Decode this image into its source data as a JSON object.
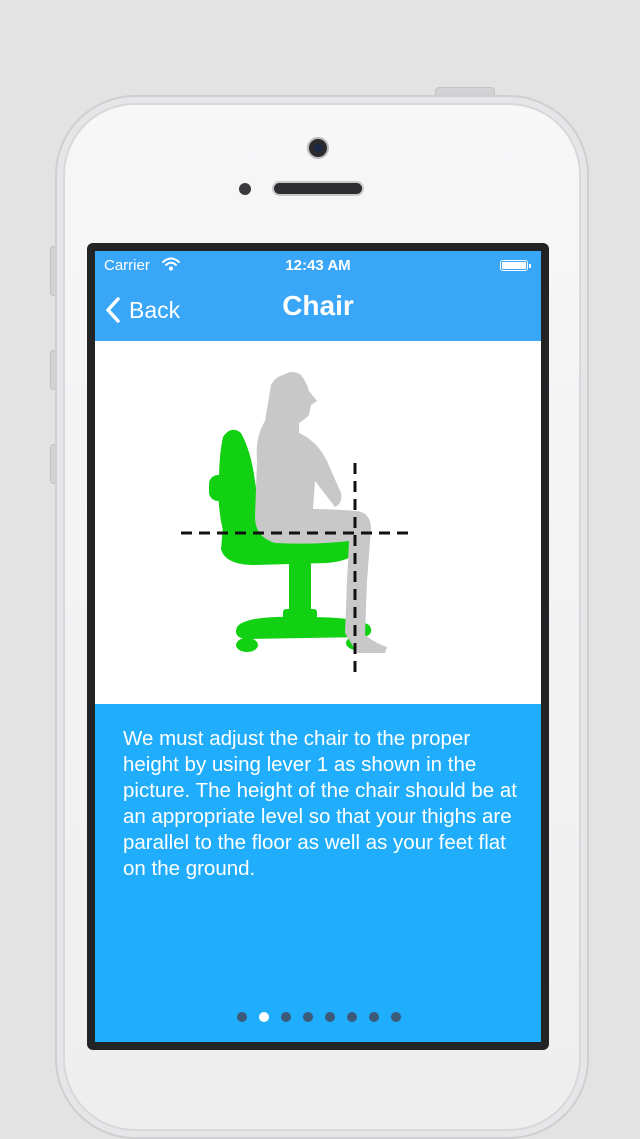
{
  "status_bar": {
    "carrier": "Carrier",
    "time": "12:43 AM"
  },
  "nav": {
    "back_label": "Back",
    "title": "Chair"
  },
  "content": {
    "description": "We must adjust the chair to the proper height by using lever 1 as shown in the picture. The height of the chair should be at an appropriate level so that your thighs are parallel to the floor as well as your feet flat on the ground."
  },
  "pager": {
    "page_count": 8,
    "current_page": 2
  },
  "colors": {
    "nav_bar": "#3aa6f7",
    "info_panel": "#20adfb",
    "chair": "#12d112",
    "person": "#c8c8c8"
  },
  "icons": [
    "wifi-icon",
    "battery-icon",
    "chevron-left-icon"
  ]
}
